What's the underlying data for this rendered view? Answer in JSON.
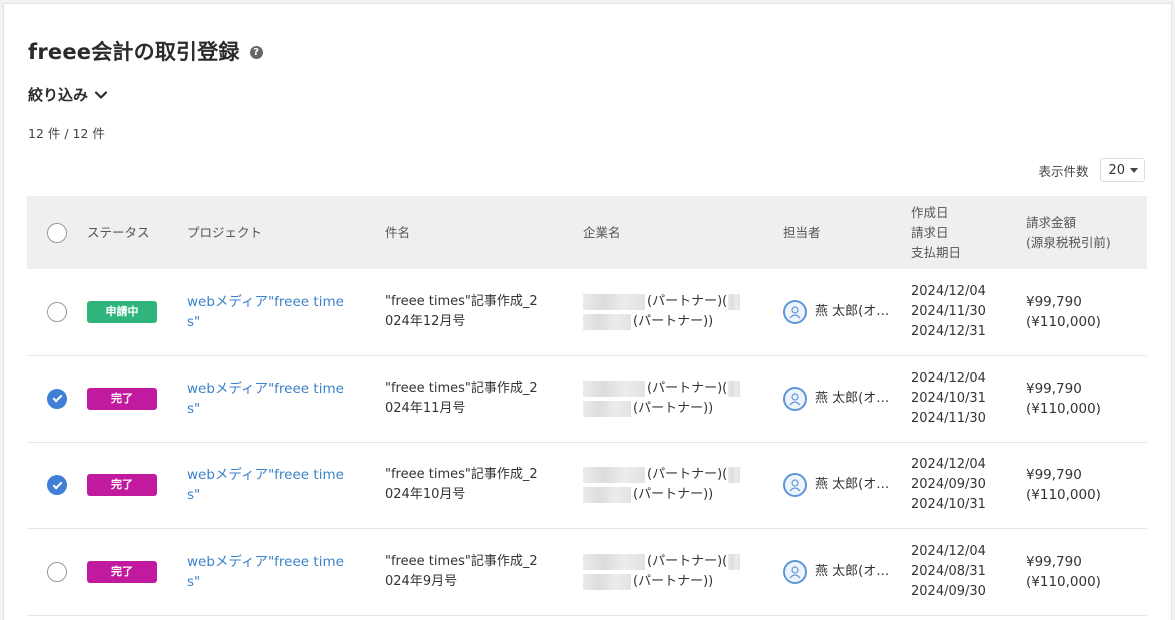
{
  "header": {
    "title": "freee会計の取引登録",
    "help_icon": "question-circle-icon"
  },
  "filter": {
    "label": "絞り込み"
  },
  "count": "12 件 / 12 件",
  "pagination": {
    "label": "表示件数",
    "value": "20"
  },
  "columns": {
    "status": "ステータス",
    "project": "プロジェクト",
    "subject": "件名",
    "company": "企業名",
    "person": "担当者",
    "dates": [
      "作成日",
      "請求日",
      "支払期日"
    ],
    "amount": [
      "請求金額",
      "(源泉税税引前)"
    ]
  },
  "colors": {
    "pending": "#2fb47c",
    "done": "#c21a9e",
    "link": "#3b82c9",
    "check": "#3f7fd6"
  },
  "rows": [
    {
      "checked": false,
      "status": "申請中",
      "status_color": "#2fb47c",
      "project": "webメディア\"freee times\"",
      "subject": "\"freee times\"記事作成_2024年12月号",
      "company_a": "(パートナー)(",
      "company_b": "(パートナー))",
      "person": "燕 太郎(オ…",
      "created": "2024/12/04",
      "invoice": "2024/11/30",
      "due": "2024/12/31",
      "amount": "¥99,790",
      "amount_gross": "(¥110,000)"
    },
    {
      "checked": true,
      "status": "完了",
      "status_color": "#c21a9e",
      "project": "webメディア\"freee times\"",
      "subject": "\"freee times\"記事作成_2024年11月号",
      "company_a": "(パートナー)(",
      "company_b": "(パートナー))",
      "person": "燕 太郎(オ…",
      "created": "2024/12/04",
      "invoice": "2024/10/31",
      "due": "2024/11/30",
      "amount": "¥99,790",
      "amount_gross": "(¥110,000)"
    },
    {
      "checked": true,
      "status": "完了",
      "status_color": "#c21a9e",
      "project": "webメディア\"freee times\"",
      "subject": "\"freee times\"記事作成_2024年10月号",
      "company_a": "(パートナー)(",
      "company_b": "(パートナー))",
      "person": "燕 太郎(オ…",
      "created": "2024/12/04",
      "invoice": "2024/09/30",
      "due": "2024/10/31",
      "amount": "¥99,790",
      "amount_gross": "(¥110,000)"
    },
    {
      "checked": false,
      "status": "完了",
      "status_color": "#c21a9e",
      "project": "webメディア\"freee times\"",
      "subject": "\"freee times\"記事作成_2024年9月号",
      "company_a": "(パートナー)(",
      "company_b": "(パートナー))",
      "person": "燕 太郎(オ…",
      "created": "2024/12/04",
      "invoice": "2024/08/31",
      "due": "2024/09/30",
      "amount": "¥99,790",
      "amount_gross": "(¥110,000)"
    }
  ]
}
